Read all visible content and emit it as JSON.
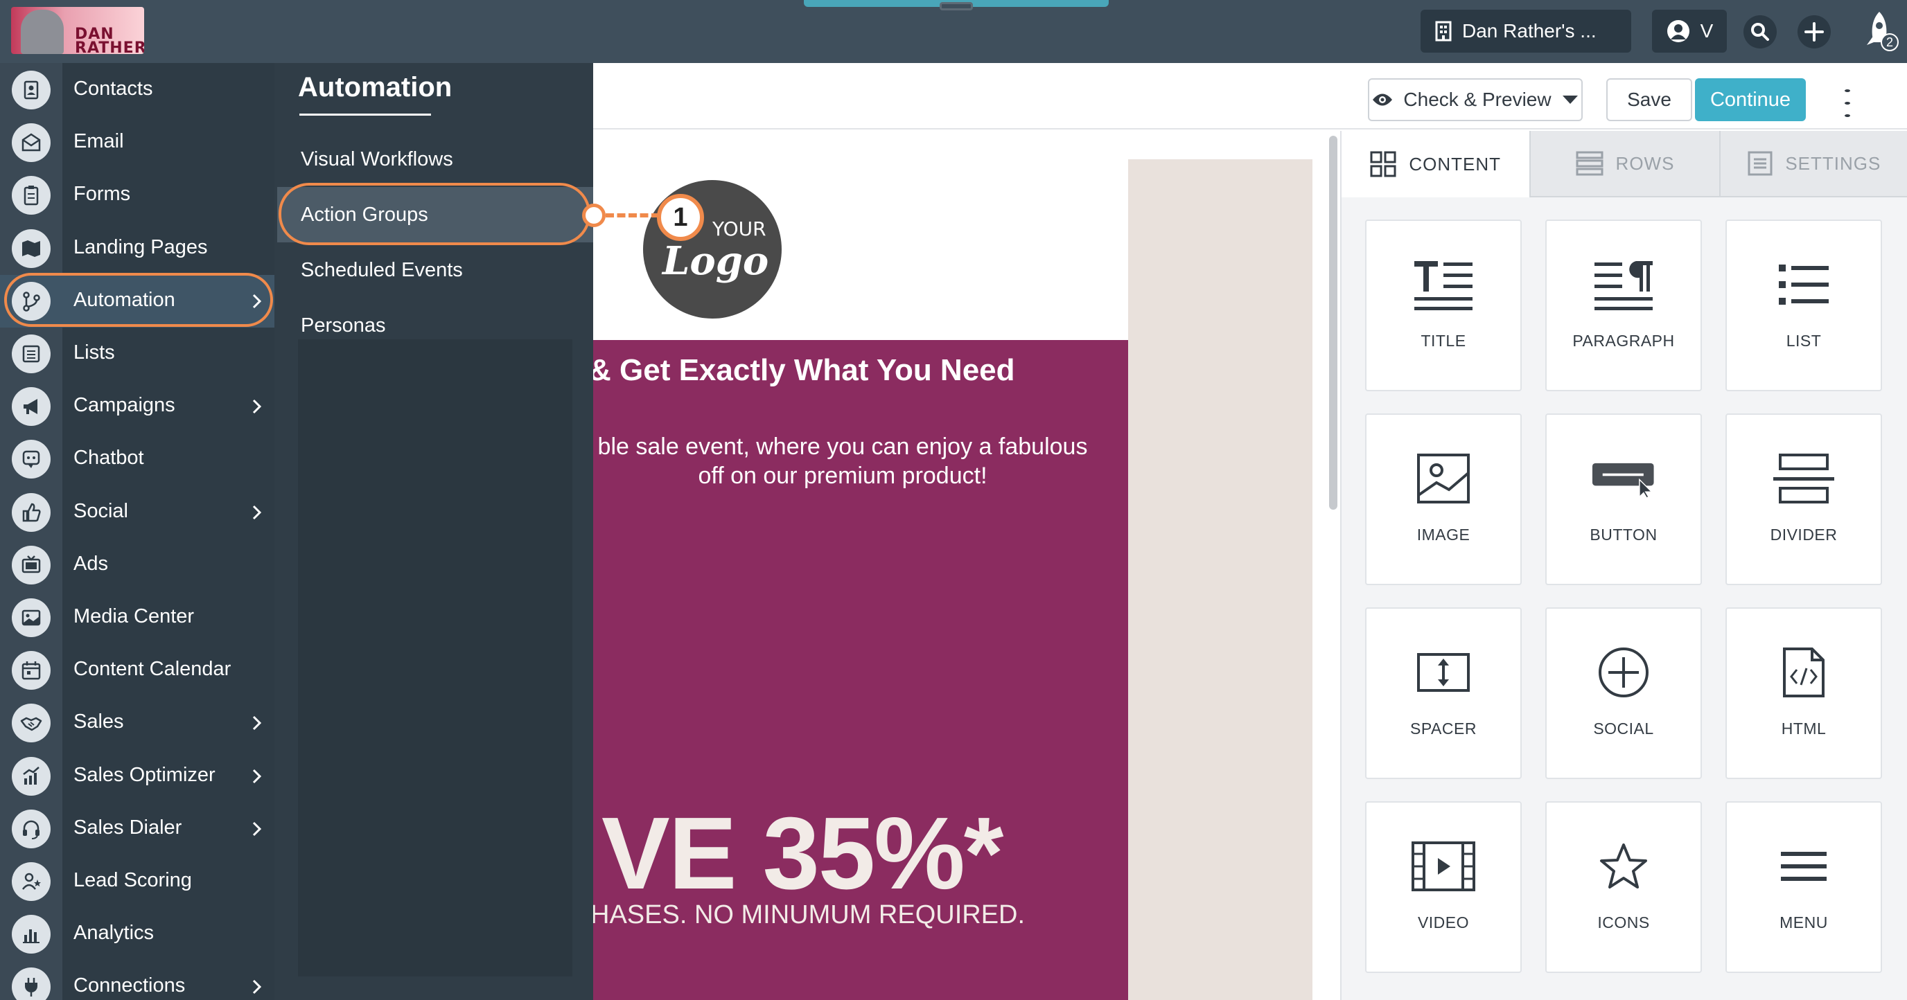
{
  "topbar": {
    "brand_text": "DAN RATHER",
    "account_name": "Dan Rather's ...",
    "user_initial": "V",
    "notification_count": "2"
  },
  "sidebar": {
    "items": [
      {
        "label": "Contacts",
        "icon": "contacts-icon",
        "has_submenu": false
      },
      {
        "label": "Email",
        "icon": "email-icon",
        "has_submenu": false
      },
      {
        "label": "Forms",
        "icon": "forms-icon",
        "has_submenu": false
      },
      {
        "label": "Landing Pages",
        "icon": "map-icon",
        "has_submenu": false
      },
      {
        "label": "Automation",
        "icon": "branch-icon",
        "has_submenu": true,
        "active": true
      },
      {
        "label": "Lists",
        "icon": "list-icon",
        "has_submenu": false
      },
      {
        "label": "Campaigns",
        "icon": "megaphone-icon",
        "has_submenu": true
      },
      {
        "label": "Chatbot",
        "icon": "chatbot-icon",
        "has_submenu": false
      },
      {
        "label": "Social",
        "icon": "thumbs-up-icon",
        "has_submenu": true
      },
      {
        "label": "Ads",
        "icon": "tv-icon",
        "has_submenu": false
      },
      {
        "label": "Media Center",
        "icon": "image-icon",
        "has_submenu": false
      },
      {
        "label": "Content Calendar",
        "icon": "calendar-icon",
        "has_submenu": false
      },
      {
        "label": "Sales",
        "icon": "handshake-icon",
        "has_submenu": true
      },
      {
        "label": "Sales Optimizer",
        "icon": "chart-up-icon",
        "has_submenu": true
      },
      {
        "label": "Sales Dialer",
        "icon": "headset-icon",
        "has_submenu": true
      },
      {
        "label": "Lead Scoring",
        "icon": "user-star-icon",
        "has_submenu": false
      },
      {
        "label": "Analytics",
        "icon": "bar-chart-icon",
        "has_submenu": false
      },
      {
        "label": "Connections",
        "icon": "plug-icon",
        "has_submenu": true
      }
    ]
  },
  "flyout": {
    "title": "Automation",
    "items": [
      {
        "label": "Visual Workflows"
      },
      {
        "label": "Action Groups",
        "highlighted": true
      },
      {
        "label": "Scheduled Events"
      },
      {
        "label": "Personas"
      }
    ],
    "callout_number": "1"
  },
  "editor": {
    "preview_label": "Check & Preview",
    "save_label": "Save",
    "continue_label": "Continue"
  },
  "email": {
    "logo_your": "YOUR",
    "logo_logo": "Logo",
    "headline": "& Get Exactly What You Need",
    "intro": "ble sale event, where you can enjoy a fabulous off on our premium product!",
    "save_banner": "VE 35%*",
    "save_sub": "HASES. NO MINUMUM REQUIRED."
  },
  "panel": {
    "tabs": [
      {
        "label": "CONTENT",
        "icon": "grid-icon",
        "active": true
      },
      {
        "label": "ROWS",
        "icon": "rows-icon",
        "active": false
      },
      {
        "label": "SETTINGS",
        "icon": "settings-list-icon",
        "active": false
      }
    ],
    "tiles": [
      {
        "label": "TITLE",
        "icon": "title-icon"
      },
      {
        "label": "PARAGRAPH",
        "icon": "paragraph-icon"
      },
      {
        "label": "LIST",
        "icon": "list-icon"
      },
      {
        "label": "IMAGE",
        "icon": "image-icon"
      },
      {
        "label": "BUTTON",
        "icon": "button-icon"
      },
      {
        "label": "DIVIDER",
        "icon": "divider-icon"
      },
      {
        "label": "SPACER",
        "icon": "spacer-icon"
      },
      {
        "label": "SOCIAL",
        "icon": "social-icon"
      },
      {
        "label": "HTML",
        "icon": "html-icon"
      },
      {
        "label": "VIDEO",
        "icon": "video-icon"
      },
      {
        "label": "ICONS",
        "icon": "star-icon"
      },
      {
        "label": "MENU",
        "icon": "menu-icon"
      }
    ]
  },
  "colors": {
    "topbar": "#3f4f5c",
    "sidebar": "#2e3b45",
    "accent": "#3fb0c9",
    "highlight": "#f08a4b",
    "hero": "#8b2c60"
  }
}
